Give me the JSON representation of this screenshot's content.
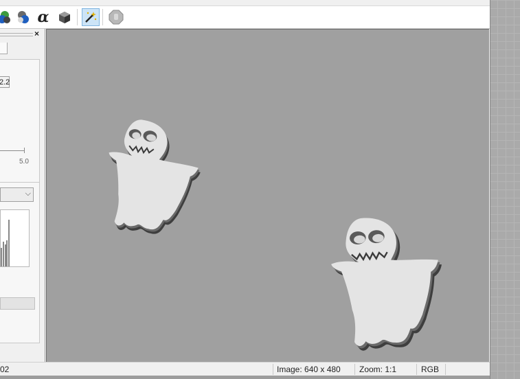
{
  "toolbar": {
    "icons": [
      "rgb-spheres-icon",
      "light-bulb-icon",
      "alpha-icon",
      "cube-icon",
      "magic-wand-icon",
      "stop-hand-icon"
    ],
    "alpha_glyph": "α",
    "active_tool": "magic-wand-icon"
  },
  "left_panel": {
    "close_glyph": "×",
    "value_field": "2.2",
    "slider_max_label": "5.0",
    "dropdown_arrow": "⌵"
  },
  "status_bar": {
    "left_text": "02",
    "image_size": "Image: 640 x 480",
    "zoom": "Zoom: 1:1",
    "color_mode": "RGB"
  },
  "colors": {
    "canvas_bg": "#a0a0a0",
    "ghost_face": "#e4e4e4",
    "ghost_shadow": "#4a4a4a",
    "active_tool_bg": "#cce4f7"
  }
}
